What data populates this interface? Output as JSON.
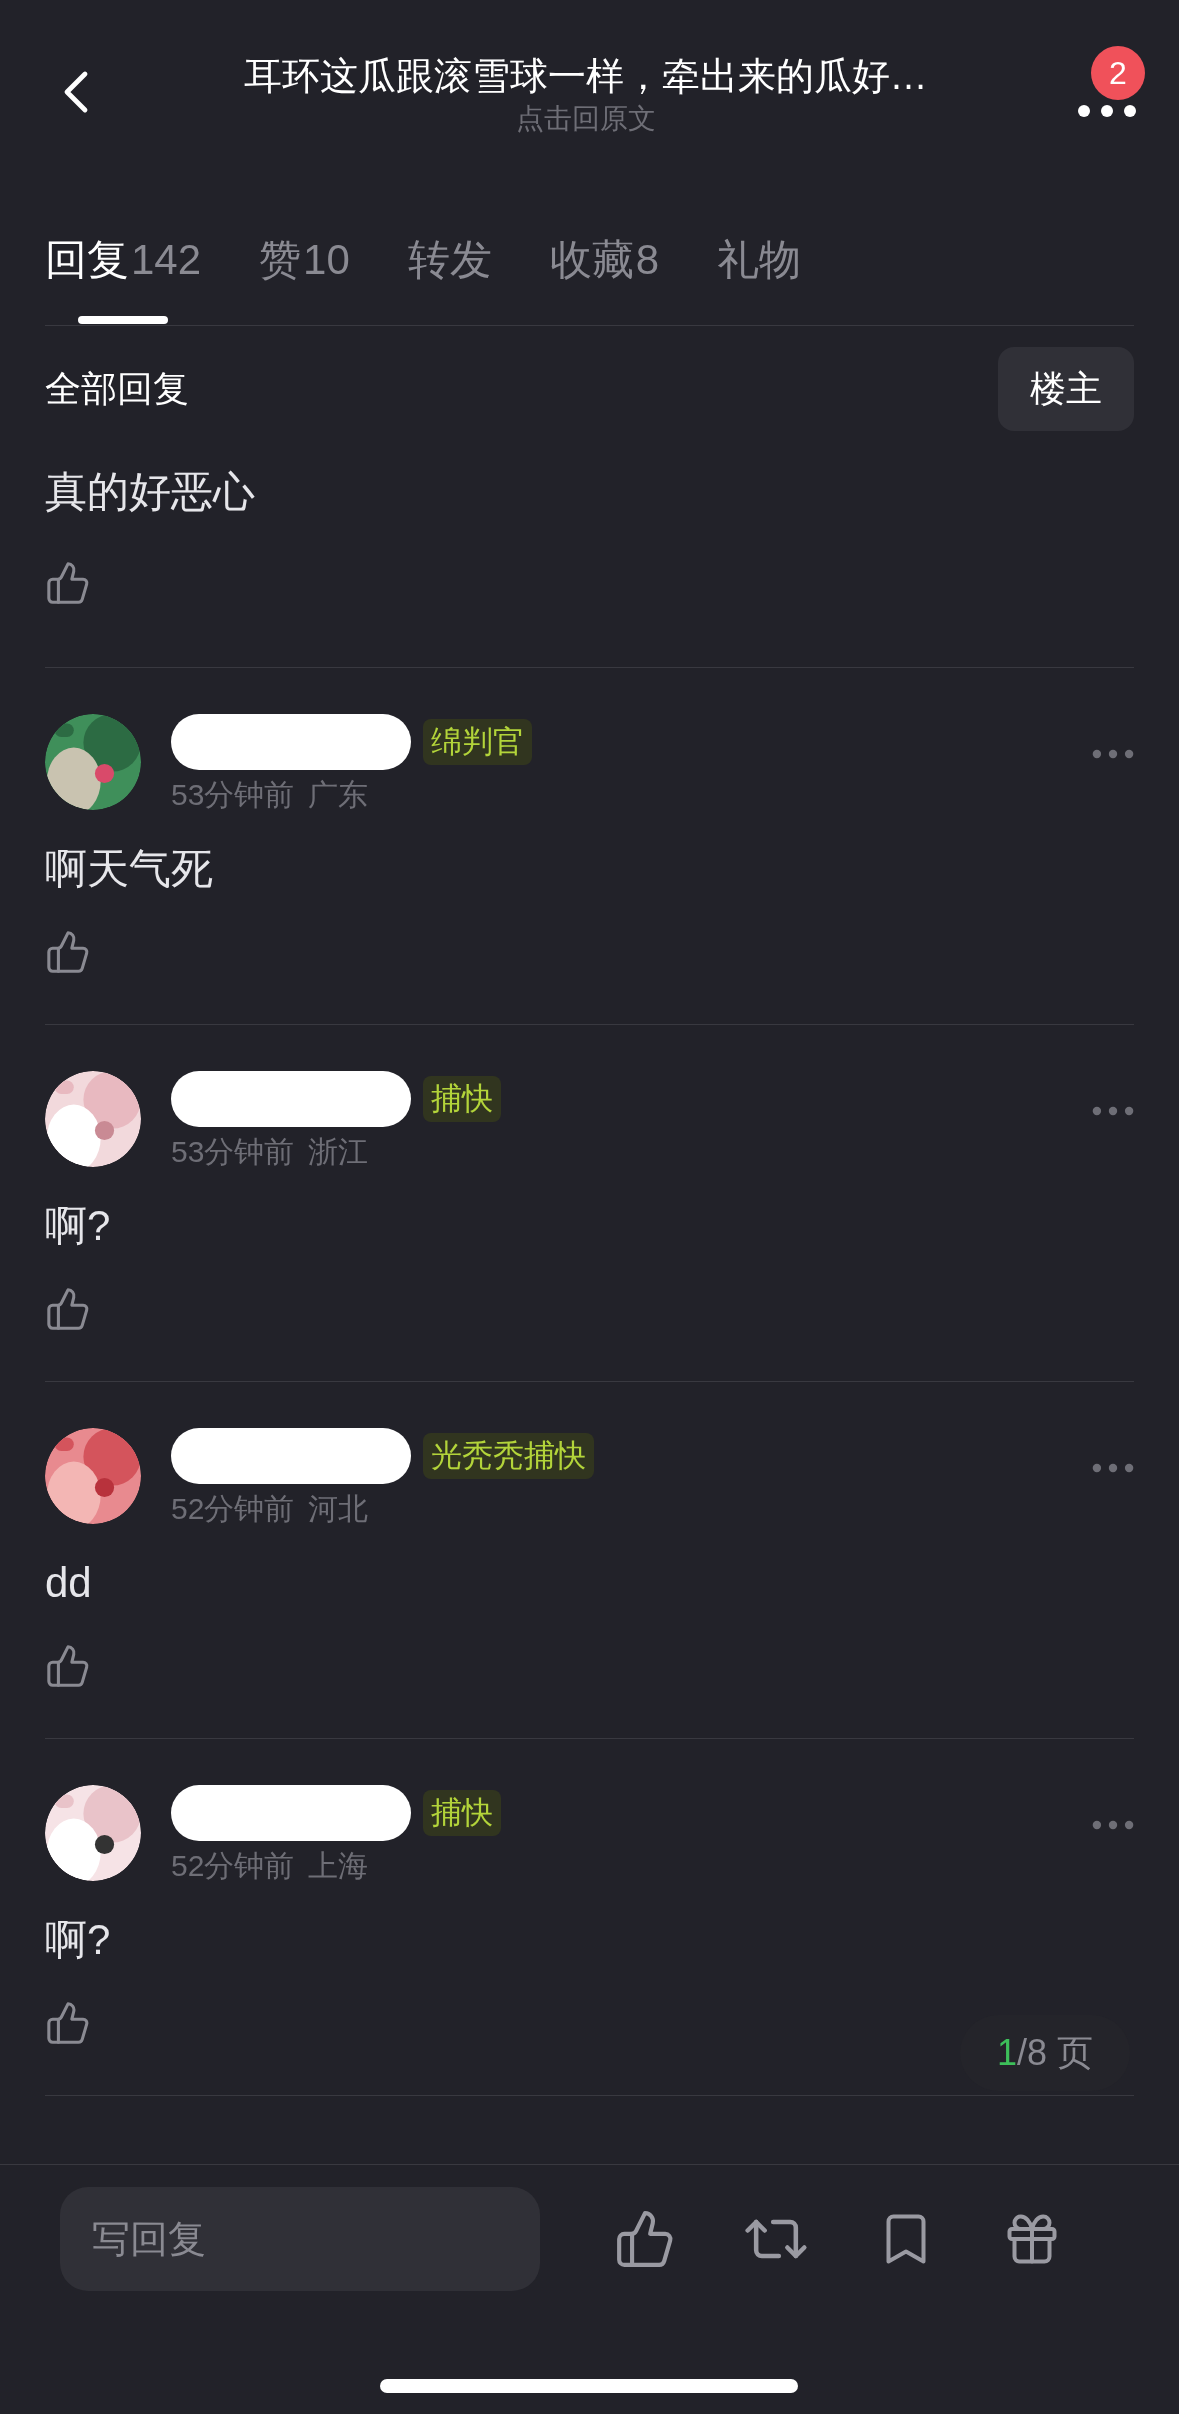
{
  "header": {
    "title": "耳环这瓜跟滚雪球一样，牵出来的瓜好…",
    "subtitle": "点击回原文",
    "notification_count": "2"
  },
  "tabs": [
    {
      "label": "回复",
      "count": "142",
      "selected": true
    },
    {
      "label": "赞",
      "count": "10",
      "selected": false
    },
    {
      "label": "转发",
      "selected": false
    },
    {
      "label": "收藏",
      "count": "8",
      "selected": false
    },
    {
      "label": "礼物",
      "selected": false
    }
  ],
  "section": {
    "title": "全部回复",
    "filter_button": "楼主"
  },
  "post_reply": {
    "text": "真的好恶心"
  },
  "comments": [
    {
      "badge": "绵判官",
      "time": "53分钟前",
      "location": "广东",
      "text": "啊天气死",
      "redacted": true
    },
    {
      "badge": "捕快",
      "time": "53分钟前",
      "location": "浙江",
      "text": "啊?",
      "redacted": true
    },
    {
      "badge": "光秃秃捕快",
      "time": "52分钟前",
      "location": "河北",
      "text": "dd",
      "redacted": true
    },
    {
      "badge": "捕快",
      "time": "52分钟前",
      "location": "上海",
      "text": "啊?",
      "redacted": true
    }
  ],
  "pager": {
    "current": "1",
    "rest": "/8 页"
  },
  "bottom_bar": {
    "placeholder": "写回复"
  }
}
